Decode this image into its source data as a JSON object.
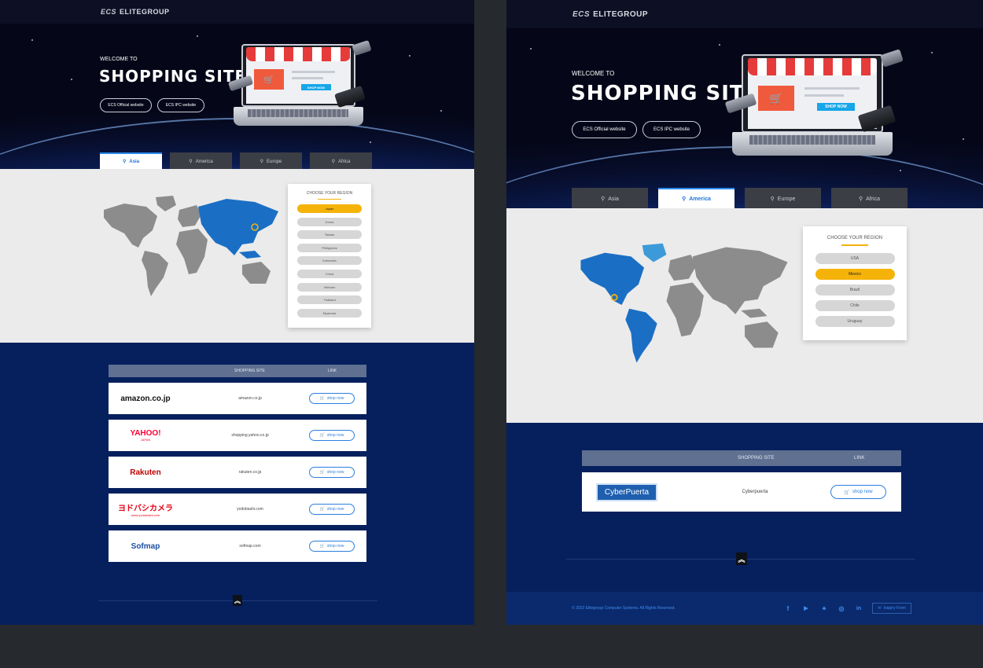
{
  "brand": {
    "logo_mark": "ECS",
    "logo_text": "ELITEGROUP"
  },
  "hero": {
    "welcome": "WELCOME TO",
    "title": "SHOPPING SITES",
    "buttons": [
      "ECS Official website",
      "ECS IPC website"
    ],
    "illustration_shop_now": "SHOP NOW"
  },
  "tabs": [
    "Asia",
    "America",
    "Europe",
    "Africa"
  ],
  "left": {
    "active_tab": "Asia",
    "region_title": "CHOOSE YOUR REGION",
    "regions": [
      "Japan",
      "Korea",
      "Taiwan",
      "Philippines",
      "Indonesia",
      "China",
      "Vietnam",
      "Thailand",
      "Myanmar"
    ],
    "active_region": "Japan",
    "table_header": {
      "site": "SHOPPING SITE",
      "link": "LINK"
    },
    "stores": [
      {
        "logo": "amazon.co.jp",
        "name": "amazon.co.jp",
        "button": "shop now",
        "color": "#111111"
      },
      {
        "logo": "YAHOO!",
        "logo_sub": "JAPAN",
        "name": "shopping.yahoo.co.jp",
        "button": "shop now",
        "color": "#ff0033"
      },
      {
        "logo": "Rakuten",
        "name": "rakuten.co.jp",
        "button": "shop now",
        "color": "#bf0000"
      },
      {
        "logo": "ヨドバシカメラ",
        "logo_sub": "www.yodobashi.com",
        "name": "yodobashi.com",
        "button": "shop now",
        "color": "#e60012"
      },
      {
        "logo": "Sofmap",
        "name": "sofmap.com",
        "button": "shop now",
        "color": "#1d4fa3"
      }
    ]
  },
  "right": {
    "active_tab": "America",
    "region_title": "CHOOSE YOUR REGION",
    "regions": [
      "USA",
      "Mexico",
      "Brazil",
      "Chile",
      "Uruguay"
    ],
    "active_region": "Mexico",
    "table_header": {
      "site": "SHOPPING SITE",
      "link": "LINK"
    },
    "stores": [
      {
        "logo": "CyberPuerta",
        "name": "Cyberpuerta",
        "button": "shop now",
        "color": "#1f5fb0"
      }
    ],
    "footer": {
      "copyright": "© 2022 Elitegroup Computer Systems. All Rights Reserved.",
      "social": [
        "facebook-icon",
        "youtube-icon",
        "twitter-icon",
        "instagram-icon",
        "linkedin-icon"
      ],
      "inquiry": "Inquiry Form"
    }
  },
  "colors": {
    "accent": "#f5b30a",
    "link": "#2a7ee0",
    "navy": "#06205e"
  }
}
